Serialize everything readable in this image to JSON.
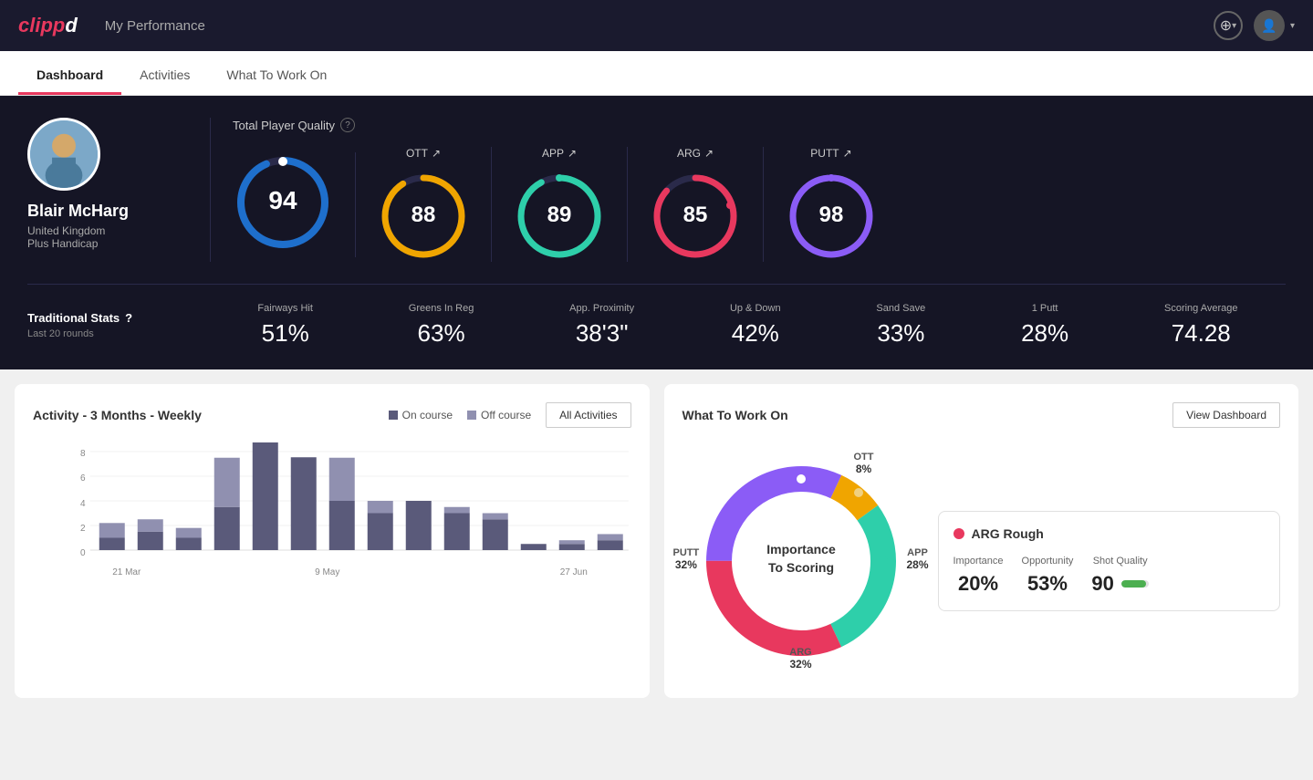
{
  "app": {
    "logo": "clippd",
    "header_title": "My Performance"
  },
  "nav": {
    "tabs": [
      {
        "label": "Dashboard",
        "active": true
      },
      {
        "label": "Activities",
        "active": false
      },
      {
        "label": "What To Work On",
        "active": false
      }
    ]
  },
  "player": {
    "name": "Blair McHarg",
    "country": "United Kingdom",
    "handicap": "Plus Handicap",
    "avatar_emoji": "🏌️"
  },
  "quality": {
    "title": "Total Player Quality",
    "main_score": 94,
    "metrics": [
      {
        "label": "OTT",
        "value": 88,
        "color": "#f0a500",
        "trail": "#3a3a5a"
      },
      {
        "label": "APP",
        "value": 89,
        "color": "#2ecfaa",
        "trail": "#3a3a5a"
      },
      {
        "label": "ARG",
        "value": 85,
        "color": "#e8385e",
        "trail": "#3a3a5a"
      },
      {
        "label": "PUTT",
        "value": 98,
        "color": "#8b5cf6",
        "trail": "#3a3a5a"
      }
    ]
  },
  "traditional_stats": {
    "title": "Traditional Stats",
    "help": "?",
    "subtitle": "Last 20 rounds",
    "stats": [
      {
        "label": "Fairways Hit",
        "value": "51%"
      },
      {
        "label": "Greens In Reg",
        "value": "63%"
      },
      {
        "label": "App. Proximity",
        "value": "38'3\""
      },
      {
        "label": "Up & Down",
        "value": "42%"
      },
      {
        "label": "Sand Save",
        "value": "33%"
      },
      {
        "label": "1 Putt",
        "value": "28%"
      },
      {
        "label": "Scoring Average",
        "value": "74.28"
      }
    ]
  },
  "activity_chart": {
    "title": "Activity - 3 Months - Weekly",
    "legend": {
      "on_course": "On course",
      "off_course": "Off course"
    },
    "all_activities_btn": "All Activities",
    "x_labels": [
      "21 Mar",
      "9 May",
      "27 Jun"
    ],
    "bars": [
      {
        "on": 1,
        "off": 1.2
      },
      {
        "on": 1.5,
        "off": 1
      },
      {
        "on": 1,
        "off": 0.8
      },
      {
        "on": 3.5,
        "off": 4
      },
      {
        "on": 9,
        "off": 0
      },
      {
        "on": 7.5,
        "off": 0
      },
      {
        "on": 4,
        "off": 3.5
      },
      {
        "on": 3,
        "off": 1
      },
      {
        "on": 4,
        "off": 0
      },
      {
        "on": 3,
        "off": 0.5
      },
      {
        "on": 2.5,
        "off": 0.5
      },
      {
        "on": 0.5,
        "off": 0
      },
      {
        "on": 0.5,
        "off": 0.3
      },
      {
        "on": 0.8,
        "off": 0.5
      }
    ]
  },
  "what_to_work_on": {
    "title": "What To Work On",
    "view_dashboard_btn": "View Dashboard",
    "donut_center_line1": "Importance",
    "donut_center_line2": "To Scoring",
    "segments": [
      {
        "label": "OTT",
        "percent": "8%",
        "color": "#f0a500"
      },
      {
        "label": "APP",
        "percent": "28%",
        "color": "#2ecfaa"
      },
      {
        "label": "ARG",
        "percent": "32%",
        "color": "#e8385e"
      },
      {
        "label": "PUTT",
        "percent": "32%",
        "color": "#8b5cf6"
      }
    ],
    "highlight_card": {
      "label": "ARG Rough",
      "dot_color": "#e8385e",
      "stats": [
        {
          "label": "Importance",
          "value": "20%"
        },
        {
          "label": "Opportunity",
          "value": "53%"
        },
        {
          "label": "Shot Quality",
          "value": "90"
        }
      ]
    }
  },
  "icons": {
    "add": "+",
    "help": "?",
    "arrow_up": "↗",
    "chevron_down": "▾"
  }
}
